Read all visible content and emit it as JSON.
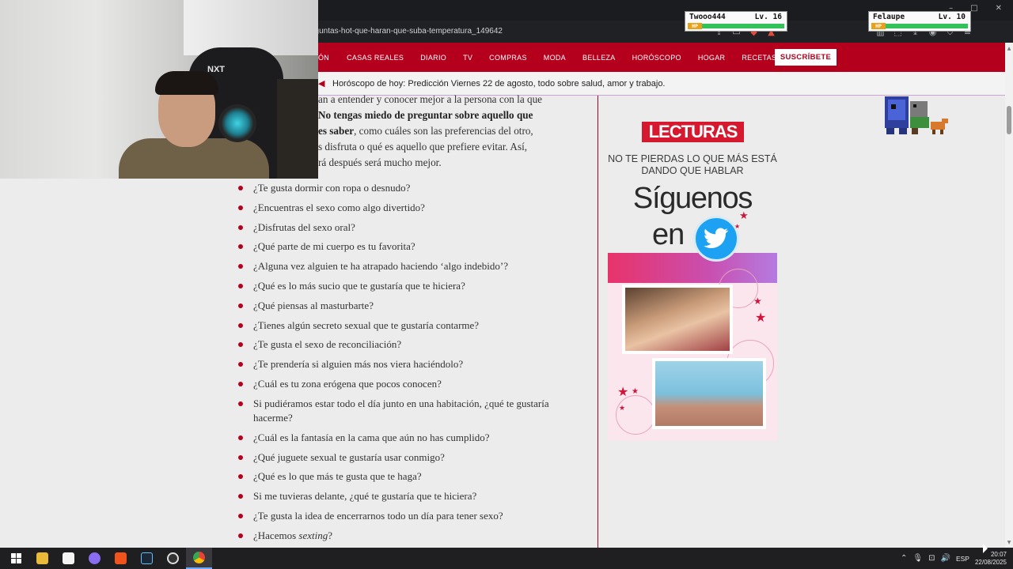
{
  "browser": {
    "url": "eguntas-hot-que-haran-que-suba-temperatura_149642",
    "window_controls": [
      "–",
      "□",
      "✕"
    ]
  },
  "nav": {
    "items": [
      "ÓN",
      "CASAS REALES",
      "DIARIO",
      "TV",
      "COMPRAS",
      "MODA",
      "BELLEZA",
      "HORÓSCOPO",
      "HOGAR",
      "RECETAS"
    ],
    "subscribe_label": "SUSCRÍBETE"
  },
  "banner": {
    "text": "Horóscopo de hoy: Predicción Viernes 22 de agosto, todo sobre salud, amor y trabajo."
  },
  "article": {
    "intro": {
      "line1": "an a entender y conocer mejor a la persona con la que",
      "line2_bold": "No tengas miedo de preguntar sobre aquello que",
      "line3_bold": "es saber",
      "line3_rest": ", como cuáles son las preferencias del otro,",
      "line4": "s disfruta o qué es aquello que prefiere evitar. Así,",
      "line5": "rá después será mucho mejor."
    },
    "questions": [
      "¿Te gusta dormir con ropa o desnudo?",
      "¿Encuentras el sexo como algo divertido?",
      "¿Disfrutas del sexo oral?",
      "¿Qué parte de mi cuerpo es tu favorita?",
      "¿Alguna vez alguien te ha atrapado haciendo ‘algo indebido’?",
      "¿Qué es lo más sucio que te gustaría que te hiciera?",
      "¿Qué piensas al masturbarte?",
      "¿Tienes algún secreto sexual que te gustaría contarme?",
      "¿Te gusta el sexo de reconciliación?",
      "¿Te prendería si alguien más nos viera haciéndolo?",
      "¿Cuál es tu zona erógena que pocos conocen?",
      "Si pudiéramos estar todo el día junto en una habitación, ¿qué te gustaría hacerme?",
      "¿Cuál es la fantasía en la cama que aún no has cumplido?",
      "¿Qué juguete sexual te gustaría usar conmigo?",
      "¿Qué es lo que más te gusta que te haga?",
      "Si me tuvieras delante, ¿qué te gustaría que te hiciera?",
      "¿Te gusta la idea de encerrarnos todo un día para tener sexo?"
    ],
    "last_question": {
      "prefix": "¿Hacemos ",
      "italic": "sexting",
      "suffix": "?"
    }
  },
  "ad": {
    "logo": "LECTURAS",
    "tagline": "NO TE PIERDAS LO QUE MÁS ESTÁ DANDO QUE HABLAR",
    "big_line1": "Síguenos",
    "big_line2": "en"
  },
  "webcam": {
    "chair_label": "NXT"
  },
  "hud": {
    "player1": {
      "name": "Twooo444",
      "level": "Lv. 16",
      "hp_label": "HP",
      "hp_fraction": 1.0
    },
    "player2": {
      "name": "Felaupe",
      "level": "Lv. 10",
      "hp_label": "HP",
      "hp_fraction": 1.0
    }
  },
  "taskbar": {
    "lang": "ESP",
    "time": "20:07",
    "date": "22/08/2025"
  },
  "colors": {
    "brand_red": "#b4001c",
    "twitter_blue": "#1da1f2",
    "hp_green": "#33c25a"
  }
}
